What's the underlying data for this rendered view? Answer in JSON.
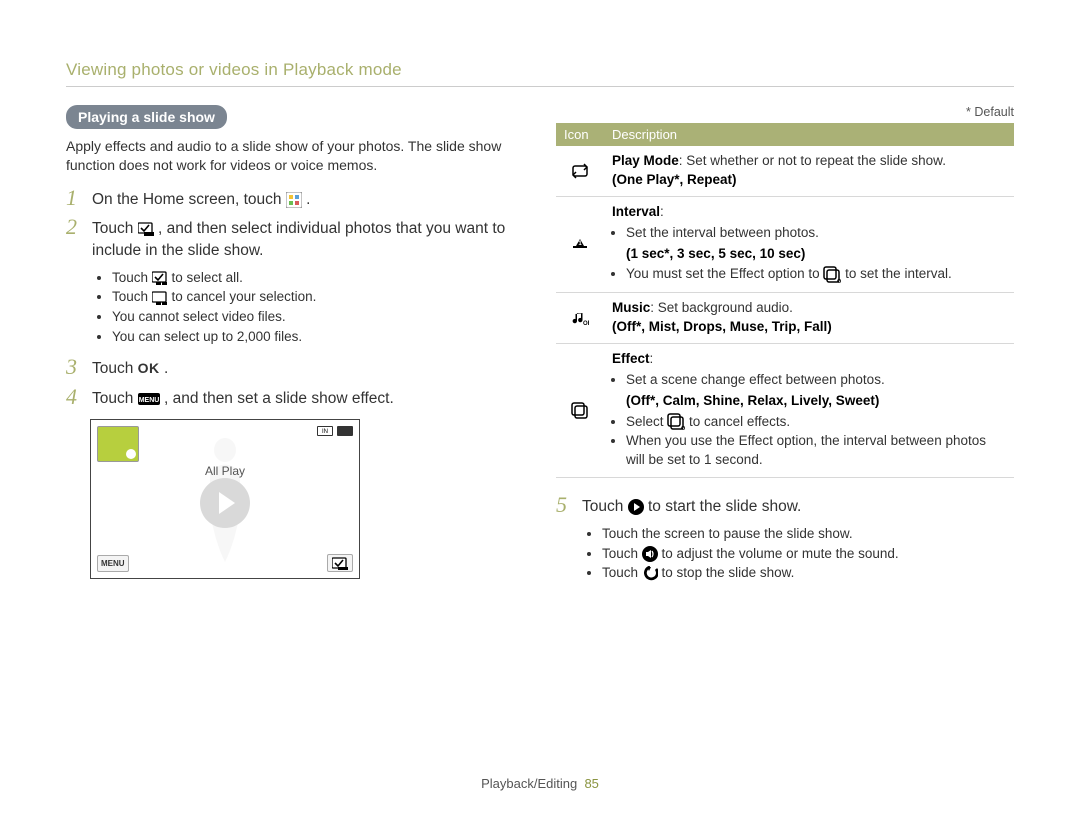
{
  "header": "Viewing photos or videos in Playback mode",
  "section_pill": "Playing a slide show",
  "intro": "Apply effects and audio to a slide show of your photos. The slide show function does not work for videos or voice memos.",
  "steps": {
    "s1": {
      "num": "1",
      "pre": "On the Home screen, touch ",
      "post": "."
    },
    "s2": {
      "num": "2",
      "pre": "Touch ",
      "post": ", and then select individual photos that you want to include in the slide show."
    },
    "s2_bullets": [
      {
        "pre": "Touch ",
        "post": " to select all."
      },
      {
        "pre": "Touch ",
        "post": " to cancel your selection."
      },
      {
        "text": "You cannot select video files."
      },
      {
        "text": "You can select up to 2,000 files."
      }
    ],
    "s3": {
      "num": "3",
      "pre": "Touch ",
      "ok": "OK",
      "post": "."
    },
    "s4": {
      "num": "4",
      "pre": "Touch ",
      "post": ", and then set a slide show effect."
    },
    "s5": {
      "num": "5",
      "pre": "Touch ",
      "post": " to start the slide show."
    },
    "s5_bullets": [
      {
        "text": "Touch the screen to pause the slide show."
      },
      {
        "pre": "Touch ",
        "post": " to adjust the volume or mute the sound."
      },
      {
        "pre": "Touch ",
        "post": " to stop the slide show."
      }
    ]
  },
  "screenshot": {
    "label": "All Play",
    "menu": "MENU"
  },
  "default_note": "* Default",
  "table": {
    "head_icon": "Icon",
    "head_desc": "Description",
    "rows": {
      "playmode": {
        "label": "Play Mode",
        "text": ": Set whether or not to repeat the slide show.",
        "options": "(One Play*, Repeat)"
      },
      "interval": {
        "label": "Interval",
        "b1": "Set the interval between photos.",
        "options": "(1 sec*, 3 sec, 5 sec, 10 sec)",
        "b2_pre": "You must set the Effect option to ",
        "b2_post": " to set the interval."
      },
      "music": {
        "label": "Music",
        "text": ": Set background audio.",
        "options": "(Off*, Mist, Drops, Muse, Trip, Fall)"
      },
      "effect": {
        "label": "Effect",
        "b1": "Set a scene change effect between photos.",
        "options": "(Off*, Calm, Shine, Relax, Lively, Sweet)",
        "b2_pre": "Select ",
        "b2_post": " to cancel effects.",
        "b3": "When you use the Effect option, the interval between photos will be set to 1 second."
      }
    }
  },
  "footer": {
    "section": "Playback/Editing",
    "page": "85"
  }
}
